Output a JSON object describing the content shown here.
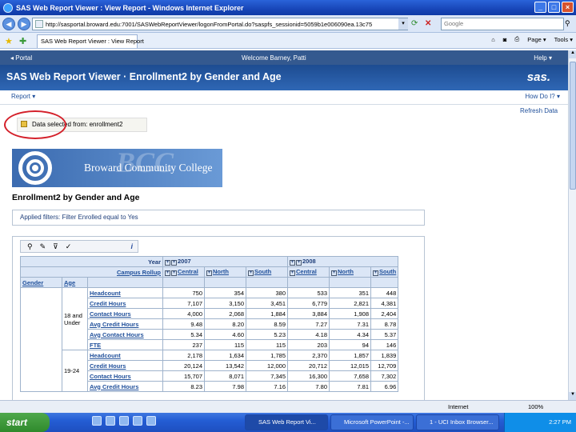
{
  "window": {
    "title": "SAS Web Report Viewer : View Report - Windows Internet Explorer",
    "min": "_",
    "max": "□",
    "close": "×"
  },
  "address": {
    "url": "http://sasportal.broward.edu:7001/SASWebReportViewer/logonFromPortal.do?saspfs_sessionid=5059b1e006090ea.13c75",
    "search_placeholder": "Google"
  },
  "browser": {
    "tab_label": "SAS Web Report Viewer : View Report",
    "tools": [
      "Page ▾",
      "Tools ▾"
    ]
  },
  "sas": {
    "portal_link": "◂ Portal",
    "welcome": "Welcome Barney, Patti",
    "help": "Help ▾",
    "header_title": "SAS Web Report Viewer  ·  Enrollment2 by Gender and Age",
    "logo_text": "sas.",
    "menu_report": "Report ▾",
    "menu_howdo": "How Do I? ▾",
    "refresh": "Refresh Data"
  },
  "data_selected": {
    "label": "Data selected from:",
    "source": "enrollment2"
  },
  "college": {
    "name": "Broward Community College",
    "watermark": "BCC"
  },
  "report": {
    "title": "Enrollment2 by Gender and Age",
    "filters": "Applied filters:  Filter Enrolled equal to Yes",
    "table_tools": [
      "⚲",
      "✎",
      "⊽",
      "✓",
      "i"
    ],
    "year_label": "Year",
    "campus_label": "Campus Rollup",
    "years": [
      "2007",
      "2008"
    ],
    "campuses": [
      "Central",
      "North",
      "South"
    ],
    "row_headers": [
      "Gender",
      "Age"
    ],
    "groups": [
      {
        "age": "18 and Under",
        "rows": [
          {
            "label": "Headcount",
            "values": [
              "750",
              "354",
              "380",
              "533",
              "351",
              "448"
            ]
          },
          {
            "label": "Credit Hours",
            "values": [
              "7,107",
              "3,150",
              "3,451",
              "6,779",
              "2,821",
              "4,381"
            ]
          },
          {
            "label": "Contact Hours",
            "values": [
              "4,000",
              "2,068",
              "1,884",
              "3,884",
              "1,908",
              "2,404"
            ]
          },
          {
            "label": "Avg Credit Hours",
            "values": [
              "9.48",
              "8.20",
              "8.59",
              "7.27",
              "7.31",
              "8.78"
            ]
          },
          {
            "label": "Avg Contact Hours",
            "values": [
              "5.34",
              "4.60",
              "5.23",
              "4.18",
              "4.34",
              "5.37"
            ]
          },
          {
            "label": "FTE",
            "values": [
              "237",
              "115",
              "115",
              "203",
              "94",
              "146"
            ]
          }
        ]
      },
      {
        "age": "19-24",
        "rows": [
          {
            "label": "Headcount",
            "values": [
              "2,178",
              "1,634",
              "1,785",
              "2,370",
              "1,857",
              "1,839"
            ]
          },
          {
            "label": "Credit Hours",
            "values": [
              "20,124",
              "13,542",
              "12,000",
              "20,712",
              "12,015",
              "12,709"
            ]
          },
          {
            "label": "Contact Hours",
            "values": [
              "15,707",
              "8,071",
              "7,345",
              "16,300",
              "7,658",
              "7,302"
            ]
          },
          {
            "label": "Avg Credit Hours",
            "values": [
              "8.23",
              "7.98",
              "7.16",
              "7.80",
              "7.81",
              "6.96"
            ]
          }
        ]
      }
    ]
  },
  "status": {
    "zone": "Internet",
    "zoom": "100%"
  },
  "taskbar": {
    "start": "start",
    "tasks": [
      "SAS Web Report Vi...",
      "Microsoft PowerPoint -...",
      "1 - UCI Inbox Browser..."
    ],
    "clock": "2:27 PM"
  }
}
